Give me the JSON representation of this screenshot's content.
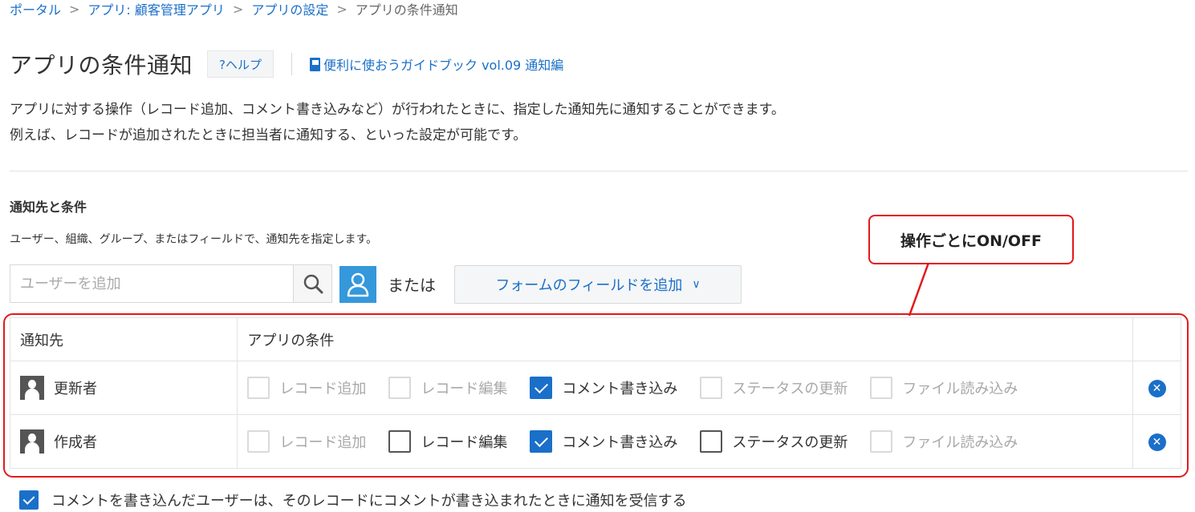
{
  "breadcrumb": {
    "items": [
      "ポータル",
      "アプリ: 顧客管理アプリ",
      "アプリの設定"
    ],
    "current": "アプリの条件通知",
    "separator": ">"
  },
  "header": {
    "title": "アプリの条件通知",
    "help_label": "?ヘルプ",
    "guide_link": "便利に使おうガイドブック vol.09 通知編"
  },
  "description": {
    "line1": "アプリに対する操作（レコード追加、コメント書き込みなど）が行われたときに、指定した通知先に通知することができます。",
    "line2": "例えば、レコードが追加されたときに担当者に通知する、といった設定が可能です。"
  },
  "section": {
    "title": "通知先と条件",
    "desc": "ユーザー、組織、グループ、またはフィールドで、通知先を指定します。"
  },
  "callout": {
    "text": "操作ごとにON/OFF",
    "color": "#e3181b"
  },
  "add_target": {
    "user_placeholder": "ユーザーを追加",
    "or_text": "または",
    "field_button": "フォームのフィールドを追加",
    "chevron": "∨"
  },
  "table": {
    "headers": {
      "target": "通知先",
      "conditions": "アプリの条件"
    },
    "rows": [
      {
        "target": "更新者",
        "conditions": [
          {
            "label": "レコード追加",
            "checked": false,
            "disabled": true
          },
          {
            "label": "レコード編集",
            "checked": false,
            "disabled": true
          },
          {
            "label": "コメント書き込み",
            "checked": true,
            "disabled": false
          },
          {
            "label": "ステータスの更新",
            "checked": false,
            "disabled": true
          },
          {
            "label": "ファイル読み込み",
            "checked": false,
            "disabled": true
          }
        ]
      },
      {
        "target": "作成者",
        "conditions": [
          {
            "label": "レコード追加",
            "checked": false,
            "disabled": true
          },
          {
            "label": "レコード編集",
            "checked": false,
            "disabled": false
          },
          {
            "label": "コメント書き込み",
            "checked": true,
            "disabled": false
          },
          {
            "label": "ステータスの更新",
            "checked": false,
            "disabled": false
          },
          {
            "label": "ファイル読み込み",
            "checked": false,
            "disabled": true
          }
        ]
      }
    ]
  },
  "comment_option": {
    "label": "コメントを書き込んだユーザーは、そのレコードにコメントが書き込まれたときに通知を受信する",
    "checked": true
  },
  "colors": {
    "accent": "#1a6fc9",
    "user_button": "#3498db",
    "highlight": "#e3181b"
  }
}
